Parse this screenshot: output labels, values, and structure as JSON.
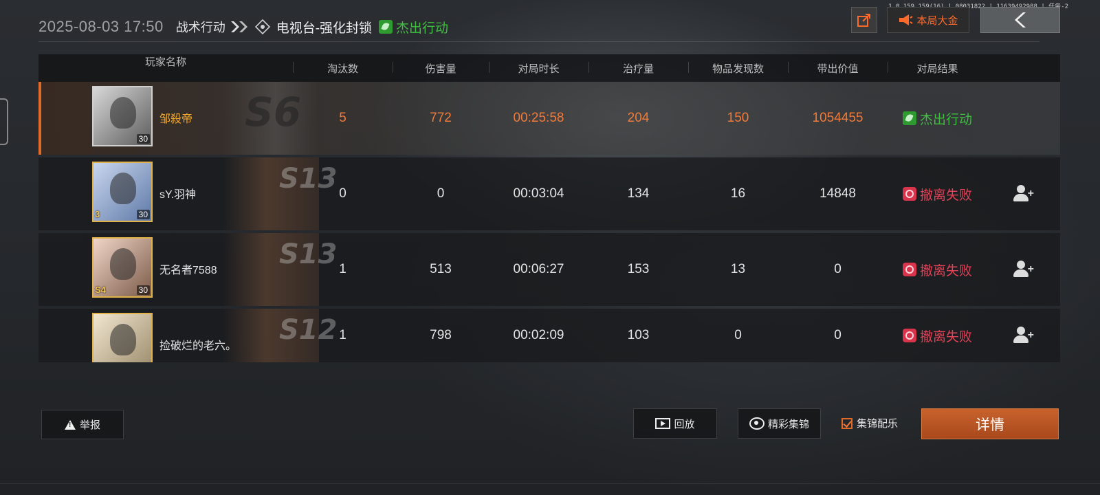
{
  "version_text": "1.0.159.159(16) | 08031822 | 11639492988 | 任务-2",
  "header": {
    "datetime": "2025-08-03 17:50",
    "mode": "战术行动",
    "map": "电视台-强化封锁",
    "result": "杰出行动"
  },
  "top_buttons": {
    "jackpot_label": "本局大金"
  },
  "columns": [
    "玩家名称",
    "淘汰数",
    "伤害量",
    "对局时长",
    "治疗量",
    "物品发现数",
    "带出价值",
    "对局结果"
  ],
  "players": [
    {
      "name": "邹殺帝",
      "season": "S6",
      "level": "30",
      "eliminations": "5",
      "damage": "772",
      "duration": "00:25:58",
      "healing": "204",
      "items_found": "150",
      "extract_value": "1054455",
      "result": "杰出行动",
      "is_self": true
    },
    {
      "name": "sY.羽神",
      "season": "S13",
      "level": "30",
      "badge": "3",
      "eliminations": "0",
      "damage": "0",
      "duration": "00:03:04",
      "healing": "134",
      "items_found": "16",
      "extract_value": "14848",
      "result": "撤离失败",
      "is_self": false
    },
    {
      "name": "无名者7588",
      "season": "S13",
      "level": "30",
      "badge": "S4",
      "eliminations": "1",
      "damage": "513",
      "duration": "00:06:27",
      "healing": "153",
      "items_found": "13",
      "extract_value": "0",
      "result": "撤离失败",
      "is_self": false
    },
    {
      "name": "捡破烂的老六。",
      "season": "S12",
      "level": "",
      "eliminations": "1",
      "damage": "798",
      "duration": "00:02:09",
      "healing": "103",
      "items_found": "0",
      "extract_value": "0",
      "result": "撤离失败",
      "is_self": false
    }
  ],
  "bottom": {
    "report_label": "举报",
    "replay_label": "回放",
    "highlights_label": "精彩集锦",
    "music_label": "集锦配乐",
    "music_checked": true,
    "detail_label": "详情"
  },
  "colors": {
    "accent_orange": "#e06a2a",
    "success_green": "#3fbf3f",
    "fail_red": "#e44258",
    "self_name": "#f0a830"
  },
  "icons": [
    "share-icon",
    "megaphone-icon",
    "back-chevron-icon",
    "map-diamond-icon",
    "leaf-icon",
    "fail-icon",
    "add-friend-icon",
    "warning-icon",
    "film-icon",
    "camera-icon",
    "checkbox-icon"
  ]
}
